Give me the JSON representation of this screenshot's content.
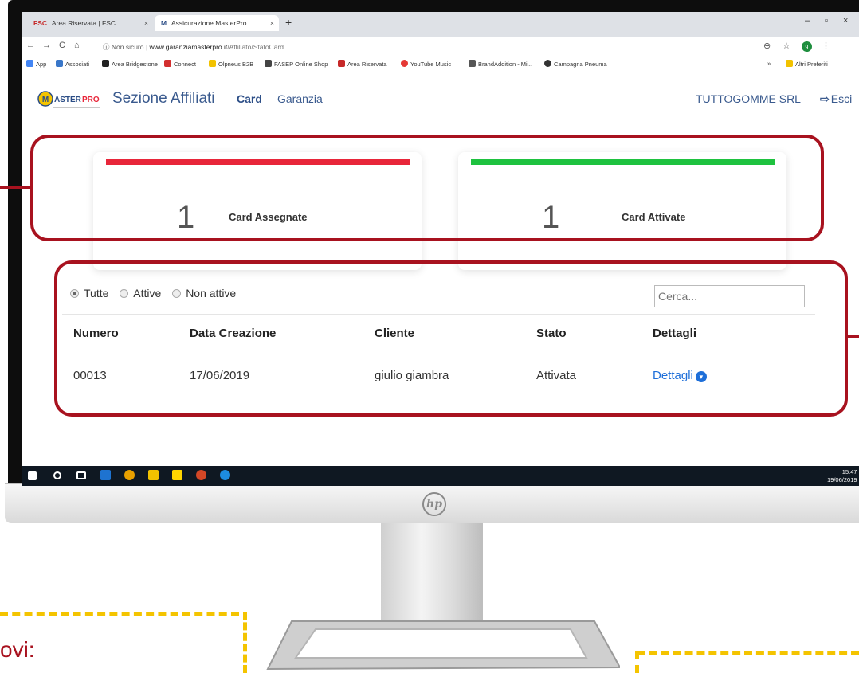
{
  "browser": {
    "tabs": [
      {
        "favicon": "FSC",
        "title": "Area Riservata | FSC"
      },
      {
        "favicon": "M",
        "title": "Assicurazione MasterPro"
      }
    ],
    "close_glyph": "×",
    "new_tab_glyph": "+",
    "window_controls": [
      "–",
      "▫",
      "×"
    ],
    "nav_glyphs": [
      "←",
      "→",
      "C",
      "⌂"
    ],
    "security": "ⓘ Non sicuro",
    "url_host": "www.garanziamasterpro.it",
    "url_path": "/Affiliato/StatoCard",
    "profile_initial": "g",
    "zoom_glyph": "⊕",
    "star_glyph": "☆",
    "menu_glyph": "⋮",
    "bookmarks": [
      {
        "label": "App",
        "color": "#4285f4"
      },
      {
        "label": "Associati",
        "color": "#3a77c9"
      },
      {
        "label": "Area Bridgestone",
        "color": "#222222"
      },
      {
        "label": "Connect",
        "color": "#d32f2f"
      },
      {
        "label": "Olpneus B2B",
        "color": "#f2c200"
      },
      {
        "label": "FASEP Online Shop",
        "color": "#444444"
      },
      {
        "label": "Area Riservata",
        "color": "#c62828"
      },
      {
        "label": "YouTube Music",
        "color": "#e53935"
      },
      {
        "label": "BrandAddition - Mi...",
        "color": "#555555"
      },
      {
        "label": "Campagna Pneuma",
        "color": "#333333"
      }
    ],
    "bookmarks_more": "»",
    "other_bookmarks": "Altri Preferiti"
  },
  "header": {
    "logo_text": "MasterPro",
    "section_title": "Sezione Affiliati",
    "nav": {
      "card": "Card",
      "garanzia": "Garanzia"
    },
    "user": "TUTTOGOMME SRL",
    "logout": "Esci"
  },
  "kpis": [
    {
      "value": "1",
      "label": "Card Assegnate",
      "color": "#e8263a"
    },
    {
      "value": "1",
      "label": "Card Attivate",
      "color": "#1ec23f"
    }
  ],
  "filters": {
    "options": [
      "Tutte",
      "Attive",
      "Non attive"
    ],
    "selected": "Tutte",
    "search_placeholder": "Cerca..."
  },
  "table": {
    "columns": [
      "Numero",
      "Data Creazione",
      "Cliente",
      "Stato",
      "Dettagli"
    ],
    "rows": [
      {
        "numero": "00013",
        "data": "17/06/2019",
        "cliente": "giulio giambra",
        "stato": "Attivata",
        "dettagli": "Dettagli"
      }
    ]
  },
  "taskbar": {
    "time": "15:47",
    "date": "19/06/2019"
  },
  "annotation": {
    "caption": "ovi:",
    "color": "#a8121f",
    "dash_color": "#f4c400"
  }
}
